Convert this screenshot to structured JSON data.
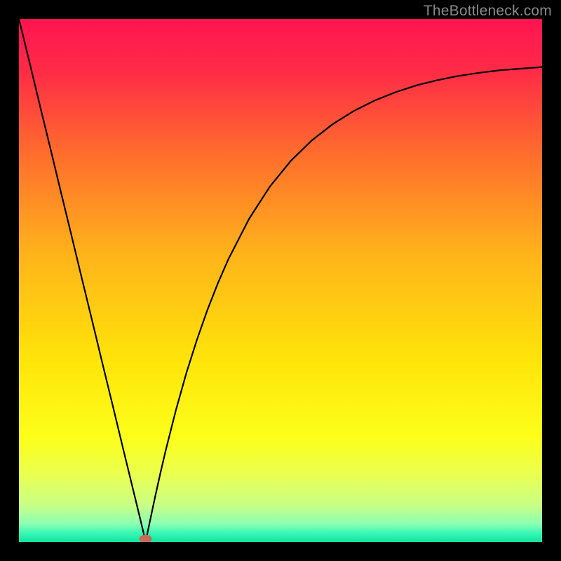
{
  "watermark": {
    "text": "TheBottleneck.com"
  },
  "chart_data": {
    "type": "line",
    "title": "",
    "xlabel": "",
    "ylabel": "",
    "xlim": [
      0,
      100
    ],
    "ylim": [
      0,
      100
    ],
    "grid": false,
    "legend": false,
    "background": {
      "type": "vertical-gradient",
      "stops": [
        {
          "offset": 0.0,
          "color": "#ff1452"
        },
        {
          "offset": 0.1,
          "color": "#ff2b46"
        },
        {
          "offset": 0.25,
          "color": "#ff6a2e"
        },
        {
          "offset": 0.45,
          "color": "#ffb31a"
        },
        {
          "offset": 0.65,
          "color": "#ffe40a"
        },
        {
          "offset": 0.8,
          "color": "#fcff1a"
        },
        {
          "offset": 0.87,
          "color": "#ebff4f"
        },
        {
          "offset": 0.93,
          "color": "#c8ff86"
        },
        {
          "offset": 0.965,
          "color": "#8cffb3"
        },
        {
          "offset": 0.985,
          "color": "#30f7b5"
        },
        {
          "offset": 1.0,
          "color": "#14e29b"
        }
      ]
    },
    "optimum_marker": {
      "x": 24.2,
      "y": 0.6,
      "color": "#c66a5a"
    },
    "series": [
      {
        "name": "bottleneck-curve",
        "color": "#000000",
        "x": [
          0,
          2,
          4,
          6,
          8,
          10,
          12,
          14,
          16,
          18,
          20,
          21,
          22,
          23,
          24,
          24.2,
          25,
          26,
          27,
          28,
          30,
          32,
          34,
          36,
          38,
          40,
          44,
          48,
          52,
          56,
          60,
          64,
          68,
          72,
          76,
          80,
          84,
          88,
          92,
          96,
          100
        ],
        "y": [
          100,
          91.8,
          83.5,
          75.3,
          67.0,
          58.8,
          50.5,
          42.3,
          34.0,
          25.8,
          17.5,
          13.4,
          9.3,
          5.2,
          1.0,
          0.0,
          3.8,
          8.5,
          13.0,
          17.3,
          25.2,
          32.3,
          38.6,
          44.3,
          49.4,
          54.0,
          61.8,
          68.0,
          72.9,
          76.8,
          79.9,
          82.4,
          84.4,
          86.0,
          87.3,
          88.3,
          89.1,
          89.7,
          90.2,
          90.5,
          90.8
        ]
      }
    ]
  }
}
